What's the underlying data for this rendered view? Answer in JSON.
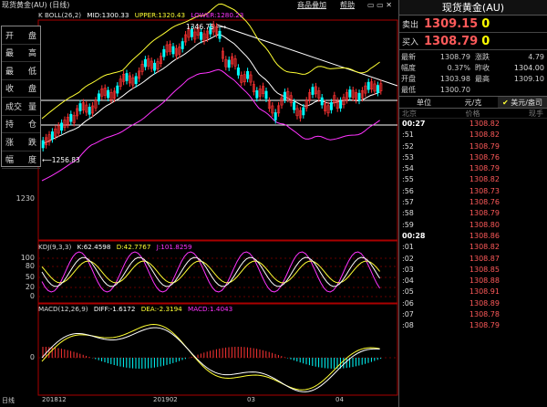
{
  "header": {
    "title": "现货黄金(AU) (日线)",
    "btn_add": "商品叠加",
    "btn_help": "帮助"
  },
  "boll": {
    "label": "K BOLL(26,2)",
    "mid": "MID:1300.33",
    "upper": "UPPER:1320.43",
    "lower": "LOWER:1280.23"
  },
  "kdj": {
    "label": "KDJ(9,3,3)",
    "k": "K:62.4598",
    "d": "D:42.7767",
    "j": "J:101.8259"
  },
  "macd": {
    "label": "MACD(12,26,9)",
    "diff": "DIFF:-1.6172",
    "dea": "DEA:-2.3194",
    "macd": "MACD:1.4043"
  },
  "left_panel": [
    [
      "开",
      "盘"
    ],
    [
      "最",
      "高"
    ],
    [
      "最",
      "低"
    ],
    [
      "收",
      "盘"
    ],
    [
      "成交",
      "量"
    ],
    [
      "持",
      "仓"
    ],
    [
      "涨",
      "跌"
    ],
    [
      "幅",
      "度"
    ]
  ],
  "annotations": {
    "high": "1346.75",
    "low": "1256.83"
  },
  "yaxis_main": [
    "1230"
  ],
  "yaxis_kdj": [
    "100",
    "80",
    "50",
    "20",
    "0"
  ],
  "yaxis_macd": [
    "0"
  ],
  "xaxis": [
    "201812",
    "201902",
    "03",
    "04"
  ],
  "bottom_tab": "日线",
  "quote": {
    "title": "现货黄金(AU)",
    "sell_label": "卖出",
    "sell_price": "1309.15",
    "sell_vol": "0",
    "buy_label": "买入",
    "buy_price": "1308.79",
    "buy_vol": "0",
    "rows": [
      {
        "l1": "最新",
        "v1": "1308.79",
        "l2": "涨跌",
        "v2": "4.79"
      },
      {
        "l1": "幅度",
        "v1": "0.37%",
        "l2": "昨收",
        "v2": "1304.00"
      },
      {
        "l1": "开盘",
        "v1": "1303.98",
        "l2": "最高",
        "v2": "1309.10"
      },
      {
        "l1": "最低",
        "v1": "1300.70",
        "l2": "",
        "v2": ""
      }
    ],
    "tabs": {
      "unit": "单位",
      "unit_val": "元/克",
      "usd": "美元/盎司"
    },
    "table_head": {
      "time": "北京",
      "price": "价格",
      "vol": "现手"
    },
    "ticks": [
      {
        "t": "00:27",
        "p": "1308.82",
        "b": true
      },
      {
        "t": ":51",
        "p": "1308.82"
      },
      {
        "t": ":52",
        "p": "1308.79"
      },
      {
        "t": ":53",
        "p": "1308.76"
      },
      {
        "t": ":54",
        "p": "1308.79"
      },
      {
        "t": ":55",
        "p": "1308.82"
      },
      {
        "t": ":56",
        "p": "1308.73"
      },
      {
        "t": ":57",
        "p": "1308.76"
      },
      {
        "t": ":58",
        "p": "1308.79"
      },
      {
        "t": ":59",
        "p": "1308.80"
      },
      {
        "t": "00:28",
        "p": "1308.86",
        "b": true
      },
      {
        "t": ":01",
        "p": "1308.82"
      },
      {
        "t": ":02",
        "p": "1308.87"
      },
      {
        "t": ":03",
        "p": "1308.85"
      },
      {
        "t": ":04",
        "p": "1308.88"
      },
      {
        "t": ":05",
        "p": "1308.91"
      },
      {
        "t": ":06",
        "p": "1308.89"
      },
      {
        "t": ":07",
        "p": "1308.78"
      },
      {
        "t": ":08",
        "p": "1308.79"
      }
    ]
  },
  "colors": {
    "up": "#ff3333",
    "down": "#00ffff",
    "mid": "#ffffff",
    "upper": "#ffff33",
    "lower": "#ff33ff",
    "bg": "#000000"
  }
}
